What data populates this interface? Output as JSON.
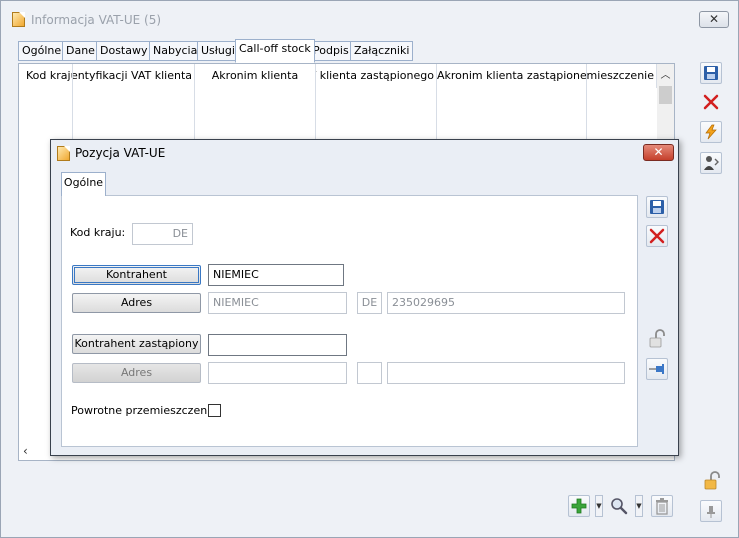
{
  "outer": {
    "title": "Informacja VAT-UE (5)",
    "close_glyph": "✕",
    "tabs": [
      {
        "label": "Ogólne",
        "active": false
      },
      {
        "label": "Dane",
        "active": false
      },
      {
        "label": "Dostawy",
        "active": false
      },
      {
        "label": "Nabycia",
        "active": false
      },
      {
        "label": "Usługi",
        "active": false
      },
      {
        "label": "Call-off stock",
        "active": true
      },
      {
        "label": "Podpis",
        "active": false
      },
      {
        "label": "Załączniki",
        "active": false
      }
    ],
    "grid": {
      "columns": [
        "Kod kraju",
        "Numer Identyfikacji VAT klienta",
        "Akronim klienta",
        "Numer Identyfikacji VAT klienta zastąpionego",
        "Akronim klienta zastąpionego",
        "Powrotne przemieszczenie"
      ],
      "rows": []
    },
    "side_toolbar": [
      "save-icon",
      "delete-icon",
      "lightning-icon",
      "user-report-icon"
    ],
    "bottom_toolbar": [
      "add-icon",
      "search-icon",
      "trash-icon"
    ],
    "colors": {
      "window_bg": "#eef1f6",
      "dialog_bg": "#eaeef5",
      "accent_blue": "#2c5fa8",
      "delete_red": "#d21f1f",
      "add_green": "#3ba53b",
      "close_red": "#c5402c"
    }
  },
  "dialog": {
    "title": "Pozycja VAT-UE",
    "close_glyph": "✕",
    "tab": "Ogólne",
    "kod_kraju_label": "Kod kraju:",
    "kod_kraju_value": "DE",
    "kontrahent_button": "Kontrahent",
    "kontrahent_value": "NIEMIEC",
    "adres_button": "Adres",
    "adres_name": "NIEMIEC",
    "adres_country": "DE",
    "adres_nip": "235029695",
    "kontrahent_zast_button": "Kontrahent zastąpiony",
    "kontrahent_zast_value": "",
    "adres2_button": "Adres",
    "adres2_name": "",
    "adres2_country": "",
    "adres2_nip": "",
    "powrotne_label": "Powrotne przemieszczenie",
    "powrotne_checked": false
  }
}
